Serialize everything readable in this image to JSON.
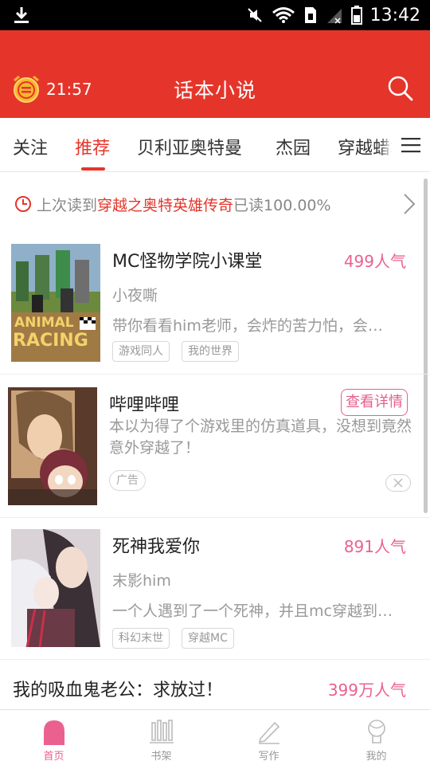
{
  "status_bar": {
    "time": "13:42"
  },
  "app_bar": {
    "timer": "21:57",
    "title": "话本小说"
  },
  "tabs": [
    {
      "label": "关注"
    },
    {
      "label": "推荐"
    },
    {
      "label": "贝利亚奥特曼"
    },
    {
      "label": "杰园"
    },
    {
      "label": "穿越蜡笔"
    }
  ],
  "last_read": {
    "prefix": "上次读到",
    "book": "穿越之奥特英雄传奇",
    "suffix": "已读100.00%"
  },
  "books": [
    {
      "title": "MC怪物学院小课堂",
      "popularity": "499人气",
      "author": "小夜嘶",
      "desc": "带你看看him老师，会炸的苦力怕，会…",
      "tags": [
        "游戏同人",
        "我的世界"
      ],
      "cover_text": [
        "ANIMAL",
        "RACING"
      ]
    },
    {
      "title": "死神我爱你",
      "popularity": "891人气",
      "author": "末影him",
      "desc": "一个人遇到了一个死神，并且mc穿越到…",
      "tags": [
        "科幻末世",
        "穿越MC"
      ]
    },
    {
      "title": "我的吸血鬼老公：求放过！",
      "popularity": "399万人气"
    }
  ],
  "ad": {
    "title": "哔哩哔哩",
    "button": "查看详情",
    "desc": "本以为得了个游戏里的仿真道具，没想到竟然意外穿越了！",
    "tag": "广告"
  },
  "bottom_nav": [
    {
      "label": "首页",
      "icon": "home-icon"
    },
    {
      "label": "书架",
      "icon": "bookshelf-icon"
    },
    {
      "label": "写作",
      "icon": "pen-icon"
    },
    {
      "label": "我的",
      "icon": "profile-icon"
    }
  ],
  "colors": {
    "brand_red": "#e5352b",
    "pink": "#ea6190"
  }
}
